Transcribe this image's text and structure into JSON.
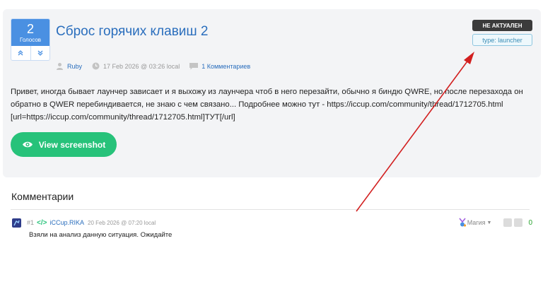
{
  "post": {
    "votes": "2",
    "votes_label": "Голосов",
    "title": "Сброс горячих клавиш 2",
    "status_badge": "НЕ АКТУАЛЕН",
    "type_badge": "type: launcher",
    "author": "Ruby",
    "date": "17 Feb 2026 @ 03:26 local",
    "comments_count": "1 Комментариев",
    "body": "Привет, иногда бывает лаунчер зависает и я выхожу из лаунчера чтоб в него перезайти, обычно я биндю QWRE, но после перезахода он обратно в QWER перебиндивается, не знаю с чем связано... Подробнее можно тут - https://iccup.com/community/thread/1712705.html [url=https://iccup.com/community/thread/1712705.html]ТУТ[/url]",
    "screenshot_button": "View screenshot"
  },
  "comments": {
    "heading": "Комментарии",
    "items": [
      {
        "number": "#1",
        "code_icon": "</>",
        "author": "iCCup.RIKA",
        "date": "20 Feb 2026 @ 07:20 local",
        "role": "Магия",
        "score": "0",
        "text": "Взяли на анализ данную ситуация. Ожидайте"
      }
    ]
  },
  "colors": {
    "accent_blue": "#4a90e2",
    "link_blue": "#2a6ebd",
    "green": "#27c27a",
    "annotation_red": "#d21f1f"
  },
  "icons": [
    "chevron-up-icon",
    "chevron-down-icon",
    "user-icon",
    "clock-icon",
    "comment-icon",
    "eye-icon",
    "code-icon",
    "magic-role-icon",
    "thumb-up-icon",
    "thumb-down-icon"
  ]
}
